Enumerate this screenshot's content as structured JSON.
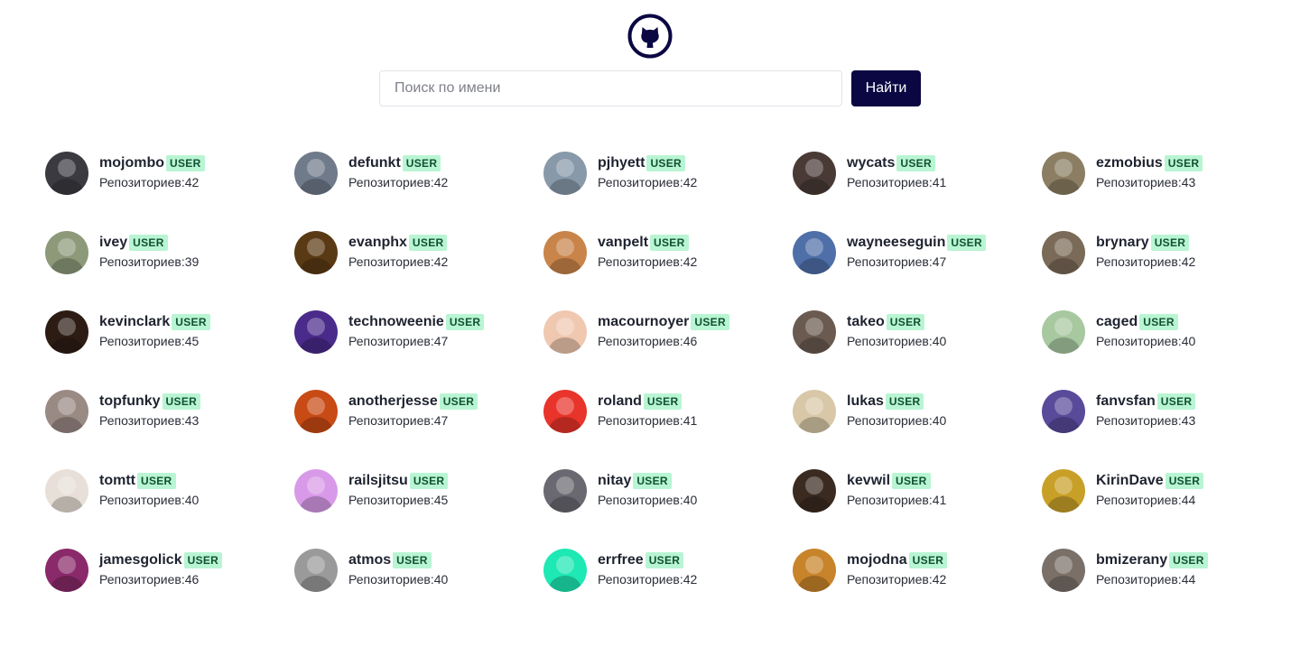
{
  "header": {
    "logo_icon": "github-octocat-icon"
  },
  "search": {
    "placeholder": "Поиск по имени",
    "value": "",
    "button_label": "Найти"
  },
  "repos_label": "Репозиториев:",
  "badge_label": "USER",
  "colors": {
    "accent": "#0b0742",
    "badge_bg": "#b9f5d3",
    "badge_text": "#0f5132"
  },
  "users": [
    {
      "login": "mojombo",
      "repos": "42",
      "avatar_color": "#3a3a40"
    },
    {
      "login": "defunkt",
      "repos": "42",
      "avatar_color": "#6f7a8a"
    },
    {
      "login": "pjhyett",
      "repos": "42",
      "avatar_color": "#8899aa"
    },
    {
      "login": "wycats",
      "repos": "41",
      "avatar_color": "#4a3a36"
    },
    {
      "login": "ezmobius",
      "repos": "43",
      "avatar_color": "#8b7e62"
    },
    {
      "login": "ivey",
      "repos": "39",
      "avatar_color": "#8d9a7a"
    },
    {
      "login": "evanphx",
      "repos": "42",
      "avatar_color": "#5a3a14"
    },
    {
      "login": "vanpelt",
      "repos": "42",
      "avatar_color": "#c9844a"
    },
    {
      "login": "wayneeseguin",
      "repos": "47",
      "avatar_color": "#4f6fa8"
    },
    {
      "login": "brynary",
      "repos": "42",
      "avatar_color": "#7a6a58"
    },
    {
      "login": "kevinclark",
      "repos": "45",
      "avatar_color": "#2d1c14"
    },
    {
      "login": "technoweenie",
      "repos": "47",
      "avatar_color": "#4a2a8a"
    },
    {
      "login": "macournoyer",
      "repos": "46",
      "avatar_color": "#f0c8b0"
    },
    {
      "login": "takeo",
      "repos": "40",
      "avatar_color": "#6a5a50"
    },
    {
      "login": "caged",
      "repos": "40",
      "avatar_color": "#a8c8a0"
    },
    {
      "login": "topfunky",
      "repos": "43",
      "avatar_color": "#9a8a84"
    },
    {
      "login": "anotherjesse",
      "repos": "47",
      "avatar_color": "#c84a14"
    },
    {
      "login": "roland",
      "repos": "41",
      "avatar_color": "#e8342a"
    },
    {
      "login": "lukas",
      "repos": "40",
      "avatar_color": "#d8c8a8"
    },
    {
      "login": "fanvsfan",
      "repos": "43",
      "avatar_color": "#5a4a9a"
    },
    {
      "login": "tomtt",
      "repos": "40",
      "avatar_color": "#e8e0d8"
    },
    {
      "login": "railsjitsu",
      "repos": "45",
      "avatar_color": "#d89ae8"
    },
    {
      "login": "nitay",
      "repos": "40",
      "avatar_color": "#6a6870"
    },
    {
      "login": "kevwil",
      "repos": "41",
      "avatar_color": "#3a2a20"
    },
    {
      "login": "KirinDave",
      "repos": "44",
      "avatar_color": "#c8a028"
    },
    {
      "login": "jamesgolick",
      "repos": "46",
      "avatar_color": "#8a2a6a"
    },
    {
      "login": "atmos",
      "repos": "40",
      "avatar_color": "#9a9a9a"
    },
    {
      "login": "errfree",
      "repos": "42",
      "avatar_color": "#1ee8b4"
    },
    {
      "login": "mojodna",
      "repos": "42",
      "avatar_color": "#c8842a"
    },
    {
      "login": "bmizerany",
      "repos": "44",
      "avatar_color": "#7a7068"
    }
  ]
}
